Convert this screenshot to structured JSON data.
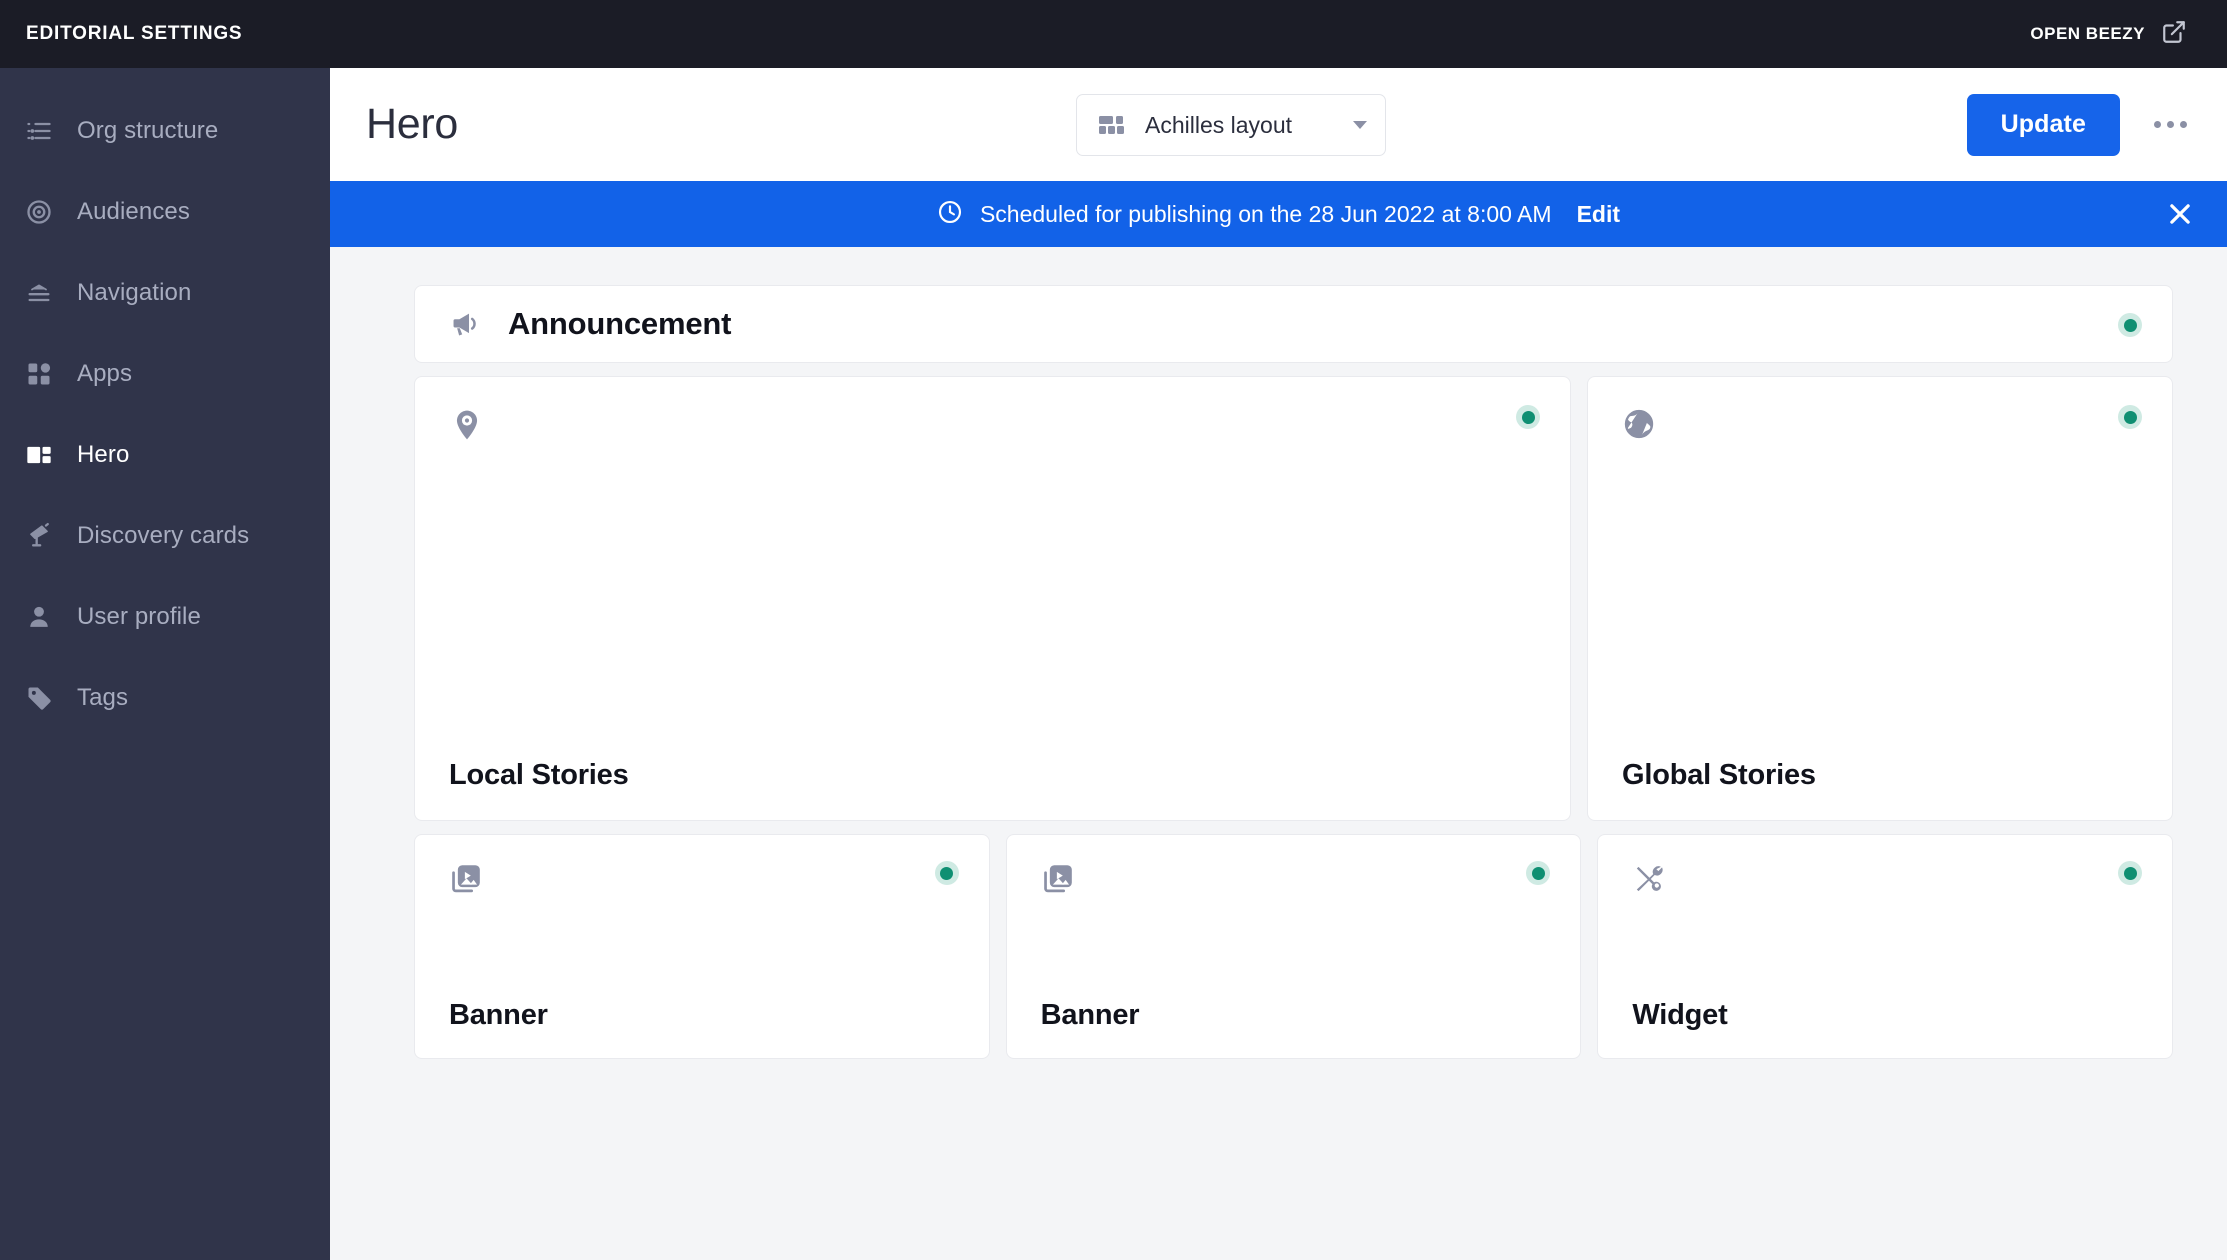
{
  "topbar": {
    "brand": "EDITORIAL SETTINGS",
    "open_app_label": "OPEN BEEZY",
    "external_link_icon": "external-link-icon",
    "background": "#1b1c26"
  },
  "sidebar": {
    "background": "#30344a",
    "items": [
      {
        "label": "Org structure",
        "icon": "org-structure-icon",
        "active": false
      },
      {
        "label": "Audiences",
        "icon": "target-icon",
        "active": false
      },
      {
        "label": "Navigation",
        "icon": "navigation-icon",
        "active": false
      },
      {
        "label": "Apps",
        "icon": "apps-grid-icon",
        "active": false
      },
      {
        "label": "Hero",
        "icon": "hero-layout-icon",
        "active": true
      },
      {
        "label": "Discovery cards",
        "icon": "telescope-icon",
        "active": false
      },
      {
        "label": "User profile",
        "icon": "person-icon",
        "active": false
      },
      {
        "label": "Tags",
        "icon": "tag-icon",
        "active": false
      }
    ]
  },
  "header": {
    "title": "Hero",
    "layout_select": {
      "value": "Achilles layout",
      "icon": "layout-grid-icon",
      "caret_icon": "chevron-down-icon"
    },
    "update_label": "Update",
    "more_icon": "kebab-menu-icon"
  },
  "banner": {
    "clock_icon": "clock-icon",
    "text": "Scheduled for publishing on the 28 Jun 2022 at 8:00 AM",
    "edit_label": "Edit",
    "close_icon": "close-icon",
    "background": "#1262e8"
  },
  "content": {
    "announcement": {
      "title": "Announcement",
      "icon": "megaphone-icon",
      "status": "active"
    },
    "stories_row": [
      {
        "title": "Local Stories",
        "icon": "location-pin-icon",
        "status": "active"
      },
      {
        "title": "Global Stories",
        "icon": "globe-icon",
        "status": "active"
      }
    ],
    "bottom_row": [
      {
        "title": "Banner",
        "icon": "image-stack-icon",
        "status": "active"
      },
      {
        "title": "Banner",
        "icon": "image-stack-icon",
        "status": "active"
      },
      {
        "title": "Widget",
        "icon": "tools-icon",
        "status": "active"
      }
    ]
  },
  "colors": {
    "accent_blue": "#1664ea",
    "status_green": "#0f8f72",
    "status_green_halo": "#cfeae3",
    "icon_gray": "#8b90a5",
    "page_bg": "#f4f5f7"
  }
}
